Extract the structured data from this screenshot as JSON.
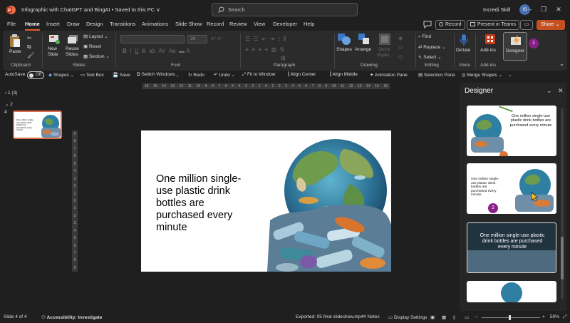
{
  "titlebar": {
    "title": "Infographic with ChatGPT and BingAI  •  Saved to this PC ∨",
    "search_placeholder": "Search",
    "user_name": "Incredi Skill",
    "avatar_initials": "IS"
  },
  "menu": {
    "tabs": [
      "File",
      "Home",
      "Insert",
      "Draw",
      "Design",
      "Transitions",
      "Animations",
      "Slide Show",
      "Record",
      "Review",
      "View",
      "Developer",
      "Help"
    ],
    "active": "Home",
    "record_label": "Record",
    "present_label": "Present in Teams",
    "share_label": "Share"
  },
  "ribbon": {
    "paste": "Paste",
    "new_slide": "New",
    "new_slide2": "Slide",
    "reuse": "Reuse",
    "reuse2": "Slides",
    "layout": "Layout",
    "reset": "Reset",
    "section": "Section",
    "font_size": "36",
    "shapes": "Shapes",
    "arrange": "Arrange",
    "quick_styles": "Quick",
    "quick_styles2": "Styles",
    "find": "Find",
    "replace": "Replace",
    "select": "Select",
    "dictate": "Dictate",
    "addins": "Add-ins",
    "designer": "Designer",
    "groups": {
      "clipboard": "Clipboard",
      "slides": "Slides",
      "font": "Font",
      "paragraph": "Paragraph",
      "drawing": "Drawing",
      "editing": "Editing",
      "voice": "Voice",
      "addins": "Add-ins"
    },
    "badge1": "1"
  },
  "qat": {
    "autosave": "AutoSave",
    "autosave_state": "Off",
    "shapes": "Shapes",
    "textbox": "Text Box",
    "save": "Save",
    "switch": "Switch Windows",
    "redo": "Redo",
    "undo": "Undo",
    "fit": "Fit to Window",
    "align_center": "Align Center",
    "align_middle": "Align Middle",
    "anim_pane": "Animation Pane",
    "sel_pane": "Selection Pane",
    "merge": "Merge Shapes"
  },
  "slides_pane": {
    "section1": "1 (3)",
    "section2": "2",
    "slide_number": "4",
    "thumb_text": "One million single-use plastic drink bottles are purchased every minute"
  },
  "ruler": {
    "ticks": [
      "16",
      "15",
      "14",
      "13",
      "12",
      "11",
      "10",
      "9",
      "8",
      "7",
      "6",
      "5",
      "4",
      "3",
      "2",
      "1",
      "0",
      "1",
      "2",
      "3",
      "4",
      "5",
      "6",
      "7",
      "8",
      "9",
      "10",
      "11",
      "12",
      "13",
      "14",
      "15",
      "16"
    ],
    "vticks": [
      "9",
      "8",
      "7",
      "6",
      "5",
      "4",
      "3",
      "2",
      "1",
      "0",
      "1",
      "2",
      "3",
      "4",
      "5",
      "6",
      "7",
      "8",
      "9"
    ]
  },
  "slide": {
    "text": "One million single-use plastic drink bottles are purchased every minute"
  },
  "designer": {
    "title": "Designer",
    "card1_text": "One million single-use plastic drink bottles are purchased every minute",
    "card2_text": "One million single-use plastic drink bottles are purchased every minute",
    "card3_text": "One million single-use plastic drink bottles are purchased every minute",
    "badge2": "2"
  },
  "status": {
    "slide_of": "Slide 4 of 4",
    "accessibility": "Accessibility: Investigate",
    "exported": "Exported: 05 final slideshow.mp4",
    "notes": "Notes",
    "display": "Display Settings",
    "zoom": "50%"
  },
  "colors": {
    "accent": "#e35d2f",
    "share": "#c4501f",
    "badge": "#8a1f8a",
    "bg": "#1f1f1f",
    "ribbon": "#2b2b2b"
  }
}
